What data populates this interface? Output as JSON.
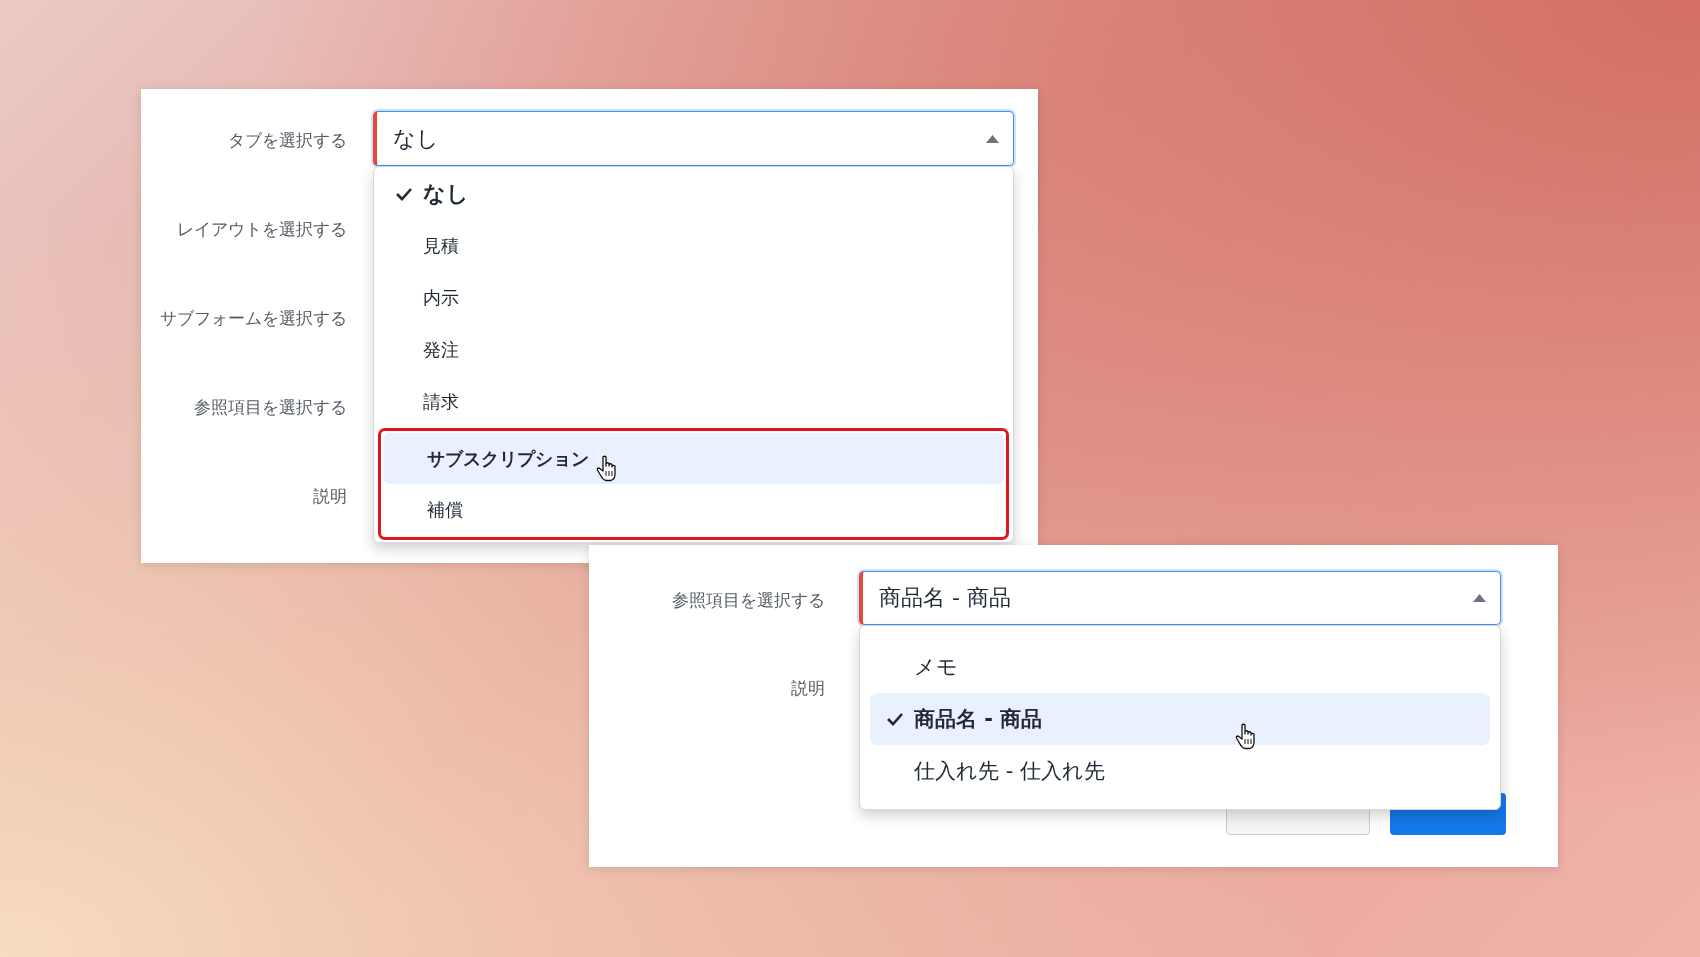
{
  "panels": [
    {
      "labels": [
        "タブを選択する",
        "レイアウトを選択する",
        "サブフォームを選択する",
        "参照項目を選択する",
        "説明"
      ],
      "select": {
        "value": "なし",
        "required": true,
        "expanded": true
      },
      "options": [
        {
          "label": "なし",
          "selected": true,
          "hovered": false,
          "emphasized": false
        },
        {
          "label": "見積",
          "selected": false,
          "hovered": false,
          "emphasized": false
        },
        {
          "label": "内示",
          "selected": false,
          "hovered": false,
          "emphasized": false
        },
        {
          "label": "発注",
          "selected": false,
          "hovered": false,
          "emphasized": false
        },
        {
          "label": "請求",
          "selected": false,
          "hovered": false,
          "emphasized": false
        },
        {
          "label": "サブスクリプション",
          "selected": false,
          "hovered": true,
          "emphasized": true
        },
        {
          "label": "補償",
          "selected": false,
          "hovered": false,
          "emphasized": true
        }
      ]
    },
    {
      "labels": [
        "参照項目を選択する",
        "説明"
      ],
      "select": {
        "value": "商品名 - 商品",
        "required": true,
        "expanded": true
      },
      "options": [
        {
          "label": "メモ",
          "selected": false,
          "hovered": false,
          "emphasized": false
        },
        {
          "label": "商品名 - 商品",
          "selected": true,
          "hovered": true,
          "emphasized": false
        },
        {
          "label": "仕入れ先 - 仕入れ先",
          "selected": false,
          "hovered": false,
          "emphasized": false
        }
      ],
      "buttons": [
        {
          "kind": "secondary"
        },
        {
          "kind": "primary"
        }
      ]
    }
  ]
}
